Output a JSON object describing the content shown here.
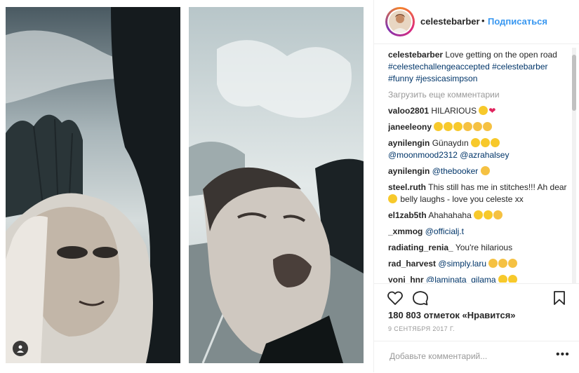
{
  "post": {
    "username": "celestebarber",
    "follow_label": "Подписаться",
    "caption_user": "celestebarber",
    "caption_text": "Love getting on the open road",
    "caption_tags": "#celestechallengeaccepted #celestebarber #funny #jessicasimpson",
    "load_more": "Загрузить еще комментарии",
    "comments": [
      {
        "user": "valoo2801",
        "text": "HILARIOUS"
      },
      {
        "user": "janeeleony",
        "text": ""
      },
      {
        "user": "aynilengin",
        "text": "Günaydın",
        "mention1": "@moonmood2312",
        "mention2": "@azrahalsey"
      },
      {
        "user": "aynilengin",
        "mention1": "@thebooker"
      },
      {
        "user": "steel.ruth",
        "text": "This still has me in stitches!!! Ah dear",
        "text2": "belly laughs - love you celeste xx"
      },
      {
        "user": "el1zab5th",
        "text": "Ahahahaha"
      },
      {
        "user": "_xmmog",
        "mention1": "@officialj.t"
      },
      {
        "user": "radiating_renia_",
        "text": "You're hilarious"
      },
      {
        "user": "rad_harvest",
        "mention1": "@simply.laru"
      },
      {
        "user": "yoni_hnr",
        "mention1": "@laminata_gilama"
      }
    ],
    "likes": "180 803 отметок «Нравится»",
    "date": "9 СЕНТЯБРЯ 2017 Г.",
    "add_comment_placeholder": "Добавьте комментарий...",
    "more_label": "•••"
  },
  "icons": [
    "heart-icon",
    "comment-icon",
    "bookmark-icon",
    "tag-user-icon"
  ],
  "colors": {
    "link": "#3897f0",
    "hashtag": "#003569",
    "muted": "#999999",
    "text": "#262626"
  }
}
